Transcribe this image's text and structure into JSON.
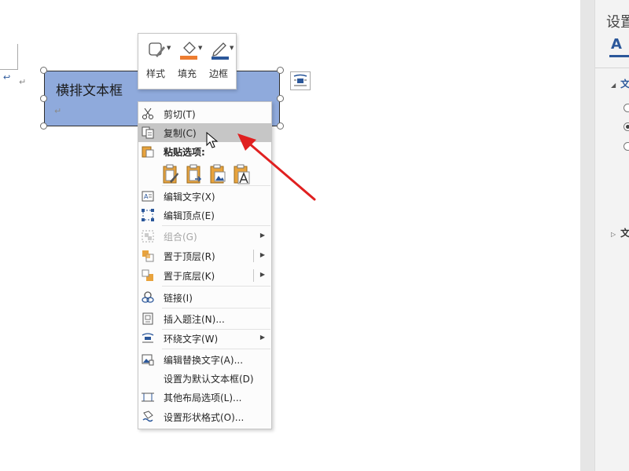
{
  "document": {
    "textbox_text": "横排文本框",
    "paragraph_mark": "↵"
  },
  "mini_toolbar": {
    "items": [
      {
        "label": "样式",
        "icon": "shape-style-icon"
      },
      {
        "label": "填充",
        "icon": "paint-bucket-icon",
        "accent": "#ed7d31"
      },
      {
        "label": "边框",
        "icon": "pen-outline-icon",
        "accent": "#2b579a"
      }
    ]
  },
  "context_menu": {
    "cut": "剪切(T)",
    "copy": "复制(C)",
    "paste_options": "粘贴选项:",
    "edit_text": "编辑文字(X)",
    "edit_points": "编辑顶点(E)",
    "group": "组合(G)",
    "bring_to_front": "置于顶层(R)",
    "send_to_back": "置于底层(K)",
    "link": "链接(I)",
    "insert_caption": "插入题注(N)...",
    "wrap_text": "环绕文字(W)",
    "edit_alt_text": "编辑替换文字(A)...",
    "set_default_textbox": "设置为默认文本框(D)",
    "more_layout": "其他布局选项(L)...",
    "format_shape": "设置形状格式(O)...",
    "highlight_color": "#c6c6c6"
  },
  "pane": {
    "title": "设置",
    "text_tab": "A",
    "section1": "文",
    "section2": "文"
  },
  "colors": {
    "textbox_fill": "#8faadc",
    "annotation_arrow": "#e02020",
    "accent_blue": "#2b579a"
  }
}
